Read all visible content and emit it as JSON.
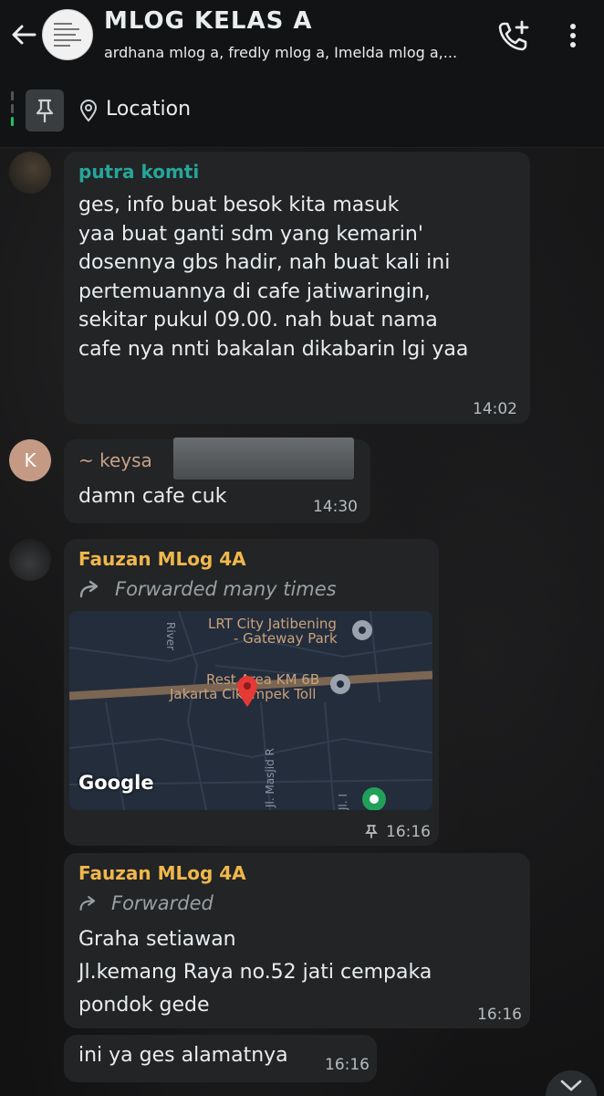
{
  "header": {
    "title": "MLOG KELAS A",
    "subtitle": "ardhana mlog a, fredly mlog a, Imelda mlog a,..."
  },
  "pinned": {
    "label": "Location"
  },
  "messages": [
    {
      "sender": "putra komti",
      "sender_color": "#26a69a",
      "text": "ges, info buat besok kita masuk\nyaa buat ganti sdm yang kemarin'\ndosennya gbs hadir, nah buat kali ini\npertemuannya di cafe jatiwaringin,\nsekitar pukul 09.00. nah buat nama\ncafe nya nnti bakalan dikabarin lgi yaa",
      "time": "14:02"
    },
    {
      "sender": "~ keysa",
      "sender_color": "#c7a188",
      "avatar_letter": "K",
      "text": "damn cafe cuk",
      "time": "14:30"
    },
    {
      "sender": "Fauzan MLog 4A",
      "sender_color": "#f0b74a",
      "forwarded": "Forwarded many times",
      "map": {
        "labels": [
          "LRT City Jatibening",
          "- Gateway Park",
          "Rest Area KM 6B",
          "Jakarta Cikampek Toll",
          "River",
          "Jl. Masjid R",
          "Jl. I"
        ],
        "logo": "Google"
      },
      "time": "16:16"
    },
    {
      "sender": "Fauzan MLog 4A",
      "sender_color": "#f0b74a",
      "forwarded": "Forwarded",
      "text": "Graha setiawan\nJl.kemang Raya no.52 jati cempaka\npondok gede",
      "time": "16:16"
    },
    {
      "text": "ini ya ges alamatnya",
      "time": "16:16"
    }
  ],
  "colors": {
    "header_bg": "#121314",
    "bubble_bg": "#222426",
    "accent_green": "#21c063"
  }
}
